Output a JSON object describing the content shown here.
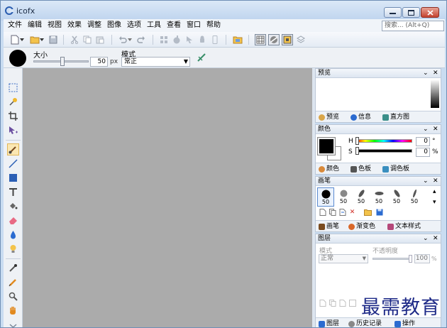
{
  "window": {
    "title": "icofx",
    "accent": "#c9dcf1"
  },
  "menu": [
    "文件",
    "编辑",
    "视图",
    "效果",
    "调整",
    "图像",
    "选项",
    "工具",
    "查看",
    "窗口",
    "帮助"
  ],
  "search": {
    "placeholder": "搜索... (Alt+Q)"
  },
  "options": {
    "size_label": "大小",
    "size_value": "50",
    "size_unit": "px",
    "mode_label": "模式",
    "mode_value": "常正"
  },
  "panels": {
    "preview": {
      "title": "预览",
      "tabs": [
        "预览",
        "信息",
        "直方图"
      ]
    },
    "color": {
      "title": "颜色",
      "h_label": "H",
      "s_label": "S",
      "h_value": "0",
      "h_unit": "°",
      "s_value": "0",
      "s_unit": "%",
      "tabs": [
        "颜色",
        "色板",
        "调色板"
      ]
    },
    "brush": {
      "title": "画笔",
      "sizes": [
        "50",
        "50",
        "50",
        "50",
        "50",
        "50"
      ],
      "tabs": [
        "画笔",
        "渐变色",
        "文本样式"
      ]
    },
    "layers": {
      "title": "图层",
      "mode_label": "模式",
      "opacity_label": "不透明度",
      "mode_value": "正常",
      "opacity_value": "100",
      "opacity_unit": "%",
      "tabs": [
        "图层",
        "历史记录",
        "操作"
      ]
    }
  },
  "watermark": "最需教育"
}
